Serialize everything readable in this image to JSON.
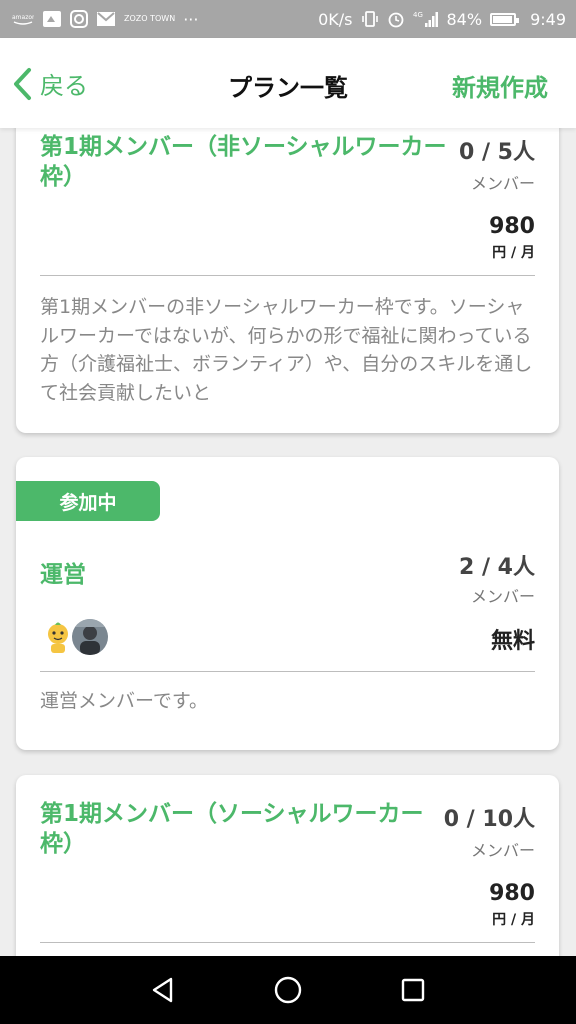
{
  "statusbar": {
    "left_icons": [
      "amazon-icon",
      "cloud-icon",
      "instagram-icon",
      "mail-icon",
      "zozotown-icon",
      "more-icon"
    ],
    "amazon_label": "amazon",
    "zozo_label": "ZOZO TOWN",
    "more_label": "···",
    "speed": "0K/s",
    "network": "4G",
    "battery": "84%",
    "battery_level": 0.84,
    "time": "9:49"
  },
  "header": {
    "back_label": "戻る",
    "title": "プラン一覧",
    "new_label": "新規作成"
  },
  "plans": [
    {
      "name_line1": "第1期メンバー（非ソーシャルワーカー",
      "name_line2": "枠）",
      "count": "0 / 5人",
      "member_label": "メンバー",
      "price": "980",
      "unit": "円 / 月",
      "description": "第1期メンバーの非ソーシャルワーカー枠です。ソーシャルワーカーではないが、何らかの形で福祉に関わっている方（介護福祉士、ボランティア）や、自分のスキルを通して社会貢献したいと"
    },
    {
      "badge": "参加中",
      "name": "運営",
      "count": "2 / 4人",
      "member_label": "メンバー",
      "price": "無料",
      "description": "運営メンバーです。"
    },
    {
      "name_line1": "第1期メンバー（ソーシャルワーカー",
      "name_line2": "枠）",
      "count": "0 / 10人",
      "member_label": "メンバー",
      "price": "980",
      "unit": "円 / 月"
    }
  ],
  "colors": {
    "accent": "#4cb86a",
    "statusbar": "#a6a6a6",
    "navbar": "#000000"
  }
}
